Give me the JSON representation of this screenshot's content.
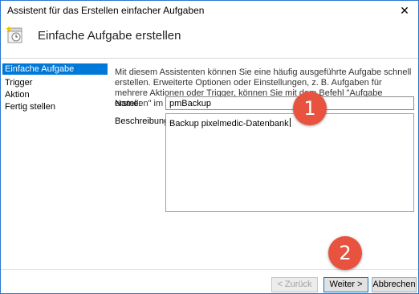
{
  "window": {
    "title": "Assistent für das Erstellen einfacher Aufgaben",
    "close_glyph": "✕"
  },
  "header": {
    "title": "Einfache Aufgabe erstellen",
    "icon": "task-clock-icon"
  },
  "sidebar": {
    "items": [
      {
        "label": "Einfache Aufgabe erstellen",
        "active": true
      },
      {
        "label": "Trigger"
      },
      {
        "label": "Aktion"
      },
      {
        "label": "Fertig stellen"
      }
    ]
  },
  "main": {
    "intro": "Mit diesem Assistenten können Sie eine häufig ausgeführte Aufgabe schnell erstellen. Erweiterte Optionen oder Einstellungen, z. B. Aufgaben für mehrere Aktionen oder Trigger, können Sie mit dem Befehl \"Aufgabe erstellen\" im Aktionsbereich festlegen.",
    "name_label": "Name:",
    "name_value": "pmBackup",
    "desc_label": "Beschreibung:",
    "desc_value": "Backup pixelmedic-Datenbank"
  },
  "buttons": {
    "back": "< Zurück",
    "next": "Weiter >",
    "cancel": "Abbrechen"
  },
  "annotations": {
    "step1": "1",
    "step2": "2"
  },
  "colors": {
    "accent": "#0078d7",
    "badge": "#e8533f"
  }
}
